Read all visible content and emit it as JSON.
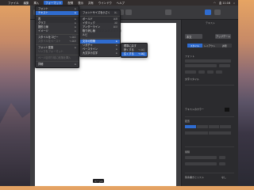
{
  "menubar": {
    "items": [
      "ファイル",
      "編集",
      "挿入",
      "フォーマット",
      "配置",
      "表示",
      "共有",
      "ウインドウ",
      "ヘルプ"
    ],
    "active_index": 3,
    "clock": "金 11:16"
  },
  "window": {
    "title": "テキスト",
    "doc_heading": "あああああああああ"
  },
  "page_indicator": "ページ1",
  "inspector": {
    "header": "テキスト",
    "style_name": "本文",
    "update_button": "アップデート",
    "tabs": [
      "スタイル",
      "レイアウト",
      "詳細"
    ],
    "font_label": "フォント",
    "font_value": "ヒラギノ角ゴシック",
    "size_value": "11 pt",
    "charstyle_label": "文字スタイル",
    "text_color_label": "テキストのカラー",
    "align_label": "配置",
    "spacing_label": "間隔",
    "bullets_label": "箇条書きとリスト",
    "bullets_value": "なし"
  },
  "format_menu": {
    "items": [
      {
        "label": "フォント",
        "arrow": true,
        "state": "normal"
      },
      {
        "label": "テキスト",
        "arrow": true,
        "state": "highlight"
      },
      {
        "label": "",
        "sep": true
      },
      {
        "label": "表",
        "arrow": true,
        "state": "normal"
      },
      {
        "label": "グラフ",
        "arrow": true,
        "state": "normal"
      },
      {
        "label": "図形と線",
        "arrow": true,
        "state": "normal"
      },
      {
        "label": "イメージ",
        "arrow": true,
        "state": "normal"
      },
      {
        "label": "",
        "sep": true
      },
      {
        "label": "スタイルをコピー",
        "shortcut": "⌥⌘C",
        "state": "normal"
      },
      {
        "label": "スタイルをペースト",
        "shortcut": "⌥⌘V",
        "state": "dim"
      },
      {
        "label": "",
        "sep": true
      },
      {
        "label": "フォント変換",
        "arrow": true,
        "state": "normal"
      },
      {
        "label": "リンクをフォーマット",
        "state": "dim"
      },
      {
        "label": "",
        "sep": true
      },
      {
        "label": "ページ区切り前に段落を挿入",
        "state": "dim"
      },
      {
        "label": "",
        "sep": true
      },
      {
        "label": "詳細",
        "arrow": true,
        "state": "normal"
      }
    ]
  },
  "text_menu": {
    "items": [
      {
        "label": "フォントサイズを小さく",
        "shortcut": "⌘-",
        "state": "normal"
      },
      {
        "label": "",
        "sep": true
      },
      {
        "label": "ボールド",
        "shortcut": "⌘B",
        "state": "normal"
      },
      {
        "label": "イタリック",
        "shortcut": "⌘I",
        "state": "normal"
      },
      {
        "label": "アンダーライン",
        "shortcut": "⌘U",
        "state": "normal"
      },
      {
        "label": "取り消し線",
        "state": "normal"
      },
      {
        "label": "ルビ",
        "state": "normal"
      },
      {
        "label": "",
        "sep": true
      },
      {
        "label": "文字の間隔",
        "arrow": true,
        "state": "highlight"
      },
      {
        "label": "リガチャ",
        "arrow": true,
        "state": "normal"
      },
      {
        "label": "ベースライン",
        "arrow": true,
        "state": "normal"
      },
      {
        "label": "大文字小文字",
        "arrow": true,
        "state": "normal"
      }
    ]
  },
  "baseline_menu": {
    "items": [
      {
        "label": "標準に戻す",
        "state": "normal"
      },
      {
        "label": "狭くする",
        "shortcut": "⌥⌘[",
        "state": "normal"
      },
      {
        "label": "広くする",
        "shortcut": "⌥⌘]",
        "state": "highlight"
      }
    ]
  }
}
